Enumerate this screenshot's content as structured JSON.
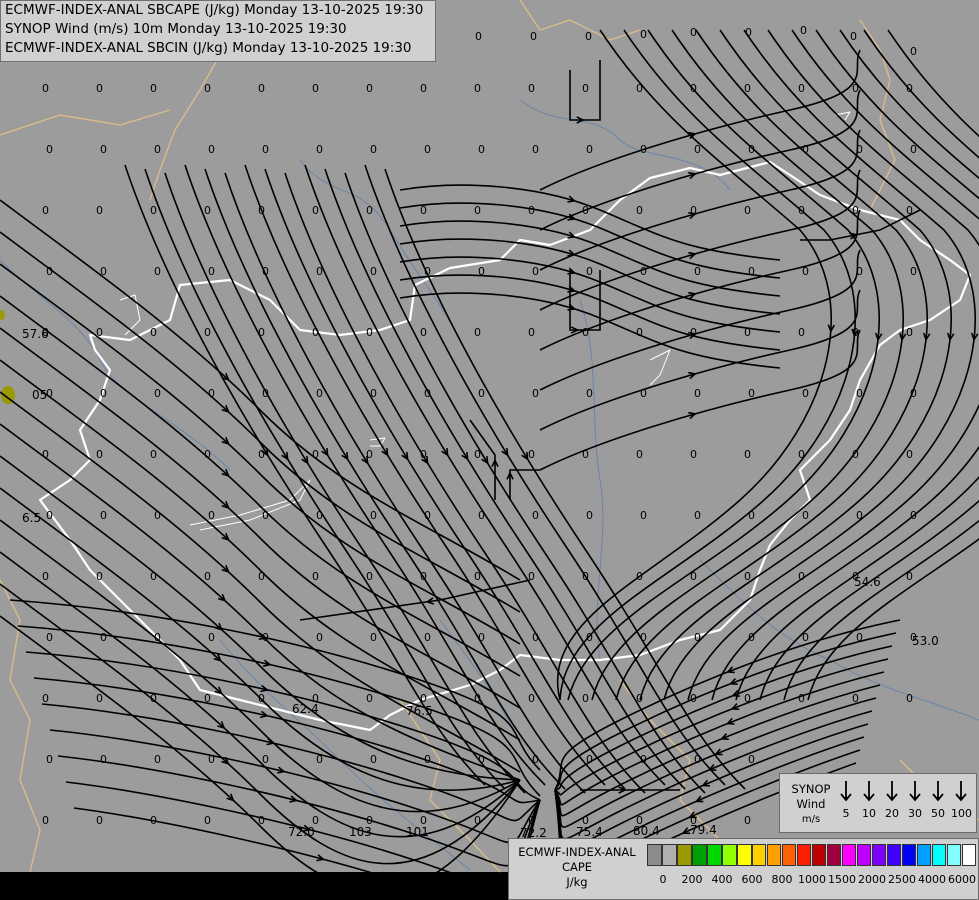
{
  "header": {
    "line1": "ECMWF-INDEX-ANAL SBCAPE (J/kg) Monday 13-10-2025 19:30",
    "line2": "SYNOP Wind (m/s) 10m Monday 13-10-2025 19:30",
    "line3": "ECMWF-INDEX-ANAL SBCIN (J/kg) Monday 13-10-2025 19:30"
  },
  "values": {
    "zero": "0",
    "v57_6": "57.6",
    "v05": "05",
    "v6_5": "6.5",
    "v54_6": "54.6",
    "v53_0": "53.0",
    "v62_4": "62.4",
    "v76_5": "76.5",
    "v72_0": "72.0",
    "v103": "103",
    "v101": "101",
    "v72_2": "72.2",
    "v75_4": "75.4",
    "v80_4": "80.4",
    "v79_4": "79.4"
  },
  "synop_legend": {
    "line1": "SYNOP",
    "line2": "Wind",
    "unit": "m/s",
    "speeds": [
      "5",
      "10",
      "20",
      "30",
      "50",
      "100"
    ]
  },
  "cape_legend": {
    "line1": "ECMWF-INDEX-ANAL",
    "line2": "CAPE",
    "unit": "J/kg",
    "colors": [
      "#8c8c8c",
      "#b0b0b0",
      "#9a9a00",
      "#00a000",
      "#00d800",
      "#90ff00",
      "#ffff00",
      "#ffd000",
      "#ffa000",
      "#ff6000",
      "#ff2000",
      "#c00000",
      "#a00040",
      "#ff00ff",
      "#c000ff",
      "#8000ff",
      "#4000ff",
      "#0000ff",
      "#00a0ff",
      "#00ffff",
      "#80ffff",
      "#ffffff"
    ],
    "ticks": [
      "0",
      "200",
      "400",
      "600",
      "800",
      "1000",
      "1500",
      "2000",
      "2500",
      "4000",
      "6000"
    ]
  },
  "map_colors": {
    "background": "#9c9c9c",
    "country_border": "#ffffff",
    "state_border": "#d8bc8a",
    "rivers": "#6a86a8",
    "streamlines": "#000000"
  }
}
